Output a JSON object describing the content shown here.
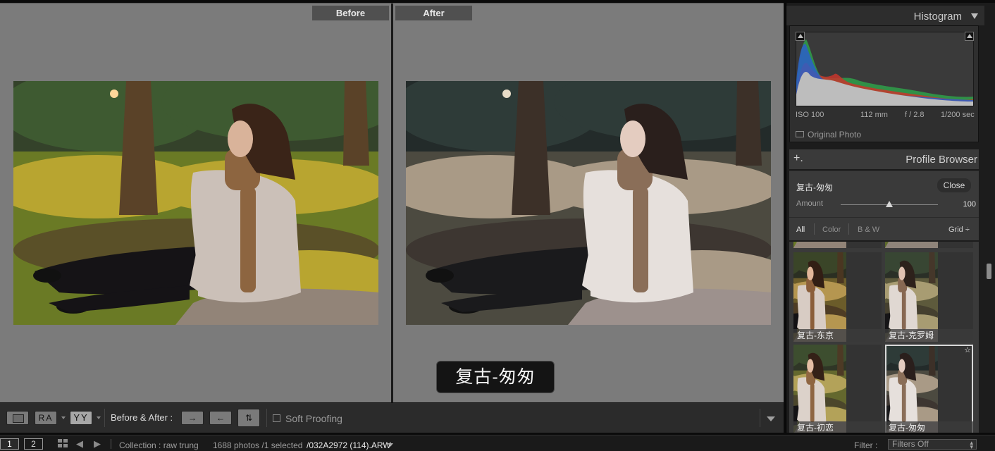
{
  "compare": {
    "before_label": "Before",
    "after_label": "After",
    "toast_text": "复古-匆匆"
  },
  "toolbar": {
    "view_loupe": "",
    "view_ra": "RA",
    "view_yy": "YY",
    "before_after_label": "Before & After :",
    "copy_right_icon": "→",
    "copy_left_icon": "←",
    "swap_icon": "⇅",
    "soft_proofing_label": "Soft Proofing"
  },
  "histogram": {
    "title": "Histogram",
    "iso": "ISO 100",
    "focal_length": "112 mm",
    "aperture": "f / 2.8",
    "shutter": "1/200 sec",
    "original_photo_label": "Original Photo"
  },
  "profile_browser": {
    "add_icon": "+.",
    "title": "Profile Browser",
    "profile_name": "复古-匆匆",
    "close_label": "Close",
    "amount_label": "Amount",
    "amount_value": "100",
    "amount_fraction": 0.5,
    "filter_all": "All",
    "filter_color": "Color",
    "filter_bw": "B & W",
    "view_mode": "Grid ÷",
    "thumbnails": [
      {
        "label": "复古-东京"
      },
      {
        "label": "复古-克罗姆"
      },
      {
        "label": "复古-初恋"
      },
      {
        "label": "复古-匆匆",
        "selected": true
      }
    ],
    "favorite_icon": "☆"
  },
  "statusbar": {
    "window_1": "1",
    "window_2": "2",
    "back_icon": "◀",
    "forward_icon": "▶",
    "collection": "Collection : raw trung",
    "photo_count": "1688 photos  /1 selected",
    "file_name": "/032A2972 (114).ARW",
    "filter_label": "Filter :",
    "filter_value": "Filters Off"
  },
  "colors": {
    "compare_background": "#7b7b7b",
    "panel_background": "#1c1c1c",
    "panel_section": "#3a3a3a"
  }
}
